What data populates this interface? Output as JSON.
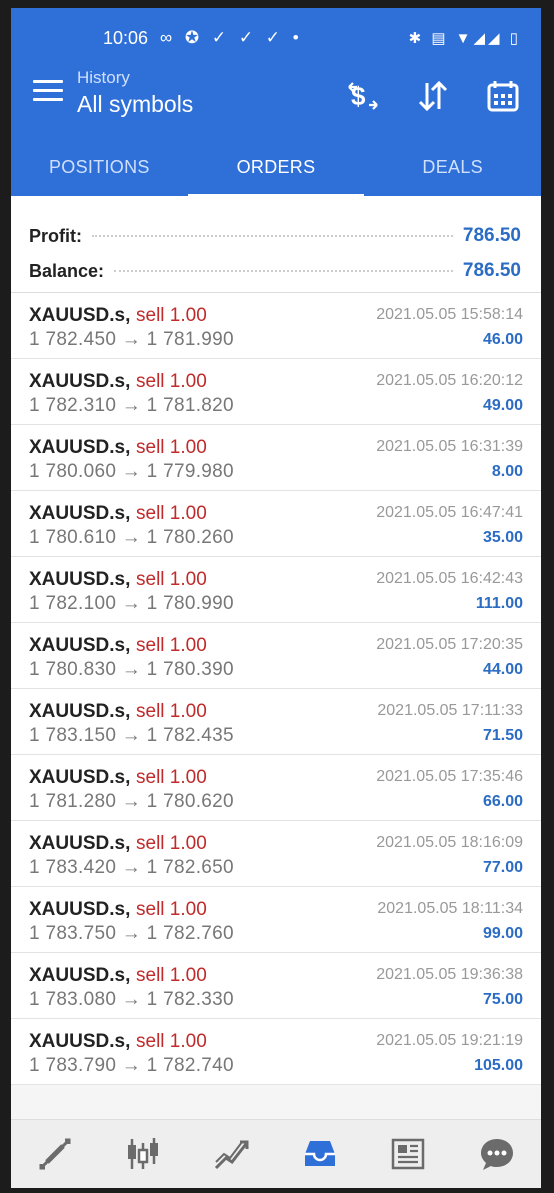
{
  "status": {
    "time": "10:06",
    "left_glyphs": "∞ ✪ ✓ ✓ ✓ •",
    "right_glyphs": "✱ ▤ ▼◢◢ ▯"
  },
  "header": {
    "subtitle": "History",
    "title": "All symbols",
    "actions": [
      "dollar-swap-icon",
      "sort-icon",
      "calendar-icon"
    ]
  },
  "tabs": [
    {
      "label": "POSITIONS"
    },
    {
      "label": "ORDERS"
    },
    {
      "label": "DEALS"
    }
  ],
  "active_tab": "ORDERS",
  "summary": {
    "profit_label": "Profit:",
    "profit": "786.50",
    "balance_label": "Balance:",
    "balance": "786.50"
  },
  "trades": [
    {
      "symbol": "XAUUSD.s,",
      "side": "sell 1.00",
      "prices": "1 782.450 → 1 781.990",
      "time": "2021.05.05 15:58:14",
      "profit": "46.00"
    },
    {
      "symbol": "XAUUSD.s,",
      "side": "sell 1.00",
      "prices": "1 782.310 → 1 781.820",
      "time": "2021.05.05 16:20:12",
      "profit": "49.00"
    },
    {
      "symbol": "XAUUSD.s,",
      "side": "sell 1.00",
      "prices": "1 780.060 → 1 779.980",
      "time": "2021.05.05 16:31:39",
      "profit": "8.00"
    },
    {
      "symbol": "XAUUSD.s,",
      "side": "sell 1.00",
      "prices": "1 780.610 → 1 780.260",
      "time": "2021.05.05 16:47:41",
      "profit": "35.00"
    },
    {
      "symbol": "XAUUSD.s,",
      "side": "sell 1.00",
      "prices": "1 782.100 → 1 780.990",
      "time": "2021.05.05 16:42:43",
      "profit": "111.00"
    },
    {
      "symbol": "XAUUSD.s,",
      "side": "sell 1.00",
      "prices": "1 780.830 → 1 780.390",
      "time": "2021.05.05 17:20:35",
      "profit": "44.00"
    },
    {
      "symbol": "XAUUSD.s,",
      "side": "sell 1.00",
      "prices": "1 783.150 → 1 782.435",
      "time": "2021.05.05 17:11:33",
      "profit": "71.50"
    },
    {
      "symbol": "XAUUSD.s,",
      "side": "sell 1.00",
      "prices": "1 781.280 → 1 780.620",
      "time": "2021.05.05 17:35:46",
      "profit": "66.00"
    },
    {
      "symbol": "XAUUSD.s,",
      "side": "sell 1.00",
      "prices": "1 783.420 → 1 782.650",
      "time": "2021.05.05 18:16:09",
      "profit": "77.00"
    },
    {
      "symbol": "XAUUSD.s,",
      "side": "sell 1.00",
      "prices": "1 783.750 → 1 782.760",
      "time": "2021.05.05 18:11:34",
      "profit": "99.00"
    },
    {
      "symbol": "XAUUSD.s,",
      "side": "sell 1.00",
      "prices": "1 783.080 → 1 782.330",
      "time": "2021.05.05 19:36:38",
      "profit": "75.00"
    },
    {
      "symbol": "XAUUSD.s,",
      "side": "sell 1.00",
      "prices": "1 783.790 → 1 782.740",
      "time": "2021.05.05 19:21:19",
      "profit": "105.00"
    }
  ],
  "bottom_nav": [
    "quotes-icon",
    "chart-icon",
    "trade-icon",
    "history-icon",
    "news-icon",
    "messages-icon"
  ],
  "colors": {
    "appbar": "#2f6fd8",
    "sell": "#c02a2a",
    "profit": "#2b6cc4"
  }
}
